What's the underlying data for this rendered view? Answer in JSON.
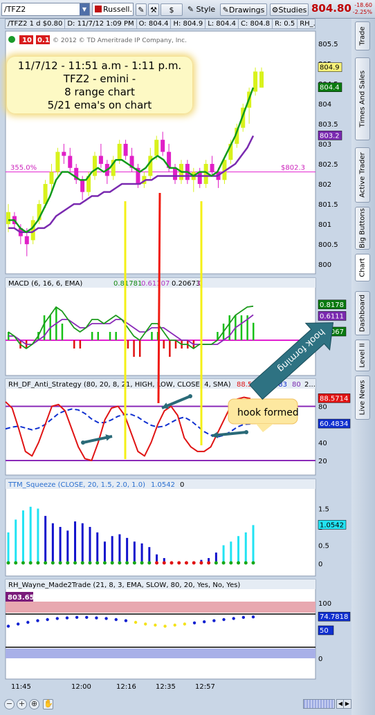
{
  "toolbar": {
    "symbol": "/TFZ2",
    "group": "Russell...",
    "style_label": "Style",
    "drawings_label": "Drawings",
    "studies_label": "Studies",
    "dollar_label": "$",
    "last_price": "804.80",
    "change": "-18.60",
    "change_pct": "-2.25%"
  },
  "header": {
    "symbol_info": "/TFZ2 1 d $0.80",
    "datetime": "D: 11/7/12 1:09 PM",
    "open": "O: 804.4",
    "high": "H: 804.9",
    "low": "L: 804.4",
    "close": "C: 804.8",
    "range": "R: 0.5",
    "study": "RH_...",
    "badge1": "10",
    "badge2": "0.1",
    "copyright": "© 2012 © TD Ameritrade IP Company, Inc."
  },
  "note": {
    "line1": "11/7/12 - 11:51 a.m - 1:11 p.m.",
    "line2": "TFZ2 - emini -",
    "line3": "8 range chart",
    "line4": "5/21 ema's on chart"
  },
  "colors": {
    "up_candle": "#d8f21c",
    "down_candle": "#e01fc7",
    "ema5": "#119a1c",
    "ema21": "#7a2ab0",
    "macd_line": "#1d9a1d",
    "macd_signal": "#8a2ab8",
    "stoch_line": "#e01414",
    "stoch_avg": "#1030d0",
    "squeeze_bars": "#1212cc",
    "squeeze_cyan": "#22e3f3",
    "yellow_line": "#f4f017",
    "red_line": "#f01a10",
    "arrow": "#2a6a78"
  },
  "panels": {
    "price": {
      "pct_label": "355.0%",
      "level_label": "$802.3",
      "level_value": 802.3,
      "y_ticks": [
        "805.5",
        "805",
        "804.5",
        "804",
        "803.5",
        "803",
        "802.5",
        "802",
        "801.5",
        "801",
        "800.5",
        "800"
      ],
      "y_range": [
        799.9,
        805.6
      ],
      "tag_close": "804.4",
      "tag_high": "804.9",
      "tag_ema21": "803.2"
    },
    "macd": {
      "label": "MACD (6, 16, 6, EMA)",
      "v1": "0.81781",
      "v2": "0.61107",
      "v3": "0.20673",
      "v4": "0",
      "tags": [
        "0.8178",
        "0.6111",
        "0.2067"
      ],
      "y_ticks": [
        "0"
      ]
    },
    "stoch": {
      "label": "RH_DF_Anti_Strategy (80, 20, 8, 21, HIGH, LOW, CLOSE, 4, SMA)",
      "v1": "88.571",
      "v2": "60.483",
      "v3": "80",
      "v4": "2...",
      "tags": [
        "88.5714",
        "60.4834"
      ],
      "y_ticks": [
        "80",
        "60",
        "40",
        "20"
      ],
      "hook_formed": "hook formed",
      "hook_forming": "hook forming"
    },
    "squeeze": {
      "label": "TTM_Squeeze (CLOSE, 20, 1.5, 2.0, 1.0)",
      "v1": "1.0542",
      "v2": "0",
      "tag": "1.0542",
      "y_ticks": [
        "1.5",
        "1",
        "0.5",
        "0"
      ]
    },
    "wayne": {
      "label": "RH_Wayne_Made2Trade (21, 8, 3, EMA, SLOW, 80, 20, Yes, No, Yes)",
      "badge": "803.65",
      "tags": [
        "74.7818",
        "50"
      ],
      "y_ticks": [
        "100",
        "50",
        "0"
      ]
    }
  },
  "x_axis": {
    "labels": [
      "11:45",
      "12:00",
      "12:16",
      "12:35",
      "12:57"
    ]
  },
  "sidebar_tabs": [
    "Trade",
    "Times And Sales",
    "Active Trader",
    "Big Buttons",
    "Chart",
    "Dashboard",
    "Level II",
    "Live News"
  ],
  "chart_data": {
    "type": "line",
    "title": "",
    "x_labels": [
      "11:45",
      "12:00",
      "12:16",
      "12:35",
      "12:57"
    ],
    "candles": [
      {
        "o": 801.0,
        "h": 801.5,
        "l": 800.8,
        "c": 801.3
      },
      {
        "o": 801.2,
        "h": 801.3,
        "l": 800.9,
        "c": 801.0
      },
      {
        "o": 800.9,
        "h": 801.0,
        "l": 800.5,
        "c": 800.7
      },
      {
        "o": 800.7,
        "h": 800.9,
        "l": 800.2,
        "c": 800.5
      },
      {
        "o": 800.6,
        "h": 801.2,
        "l": 800.5,
        "c": 801.1
      },
      {
        "o": 801.1,
        "h": 801.6,
        "l": 801.0,
        "c": 801.5
      },
      {
        "o": 801.5,
        "h": 802.1,
        "l": 801.4,
        "c": 802.0
      },
      {
        "o": 802.0,
        "h": 802.5,
        "l": 801.8,
        "c": 802.3
      },
      {
        "o": 802.3,
        "h": 802.9,
        "l": 802.2,
        "c": 802.8
      },
      {
        "o": 802.8,
        "h": 803.0,
        "l": 802.5,
        "c": 802.7
      },
      {
        "o": 802.7,
        "h": 802.9,
        "l": 802.3,
        "c": 802.4
      },
      {
        "o": 802.4,
        "h": 802.5,
        "l": 802.0,
        "c": 802.1
      },
      {
        "o": 802.1,
        "h": 802.2,
        "l": 801.6,
        "c": 801.8
      },
      {
        "o": 801.8,
        "h": 802.3,
        "l": 801.7,
        "c": 802.2
      },
      {
        "o": 802.2,
        "h": 802.8,
        "l": 802.1,
        "c": 802.7
      },
      {
        "o": 802.7,
        "h": 803.0,
        "l": 802.4,
        "c": 802.5
      },
      {
        "o": 802.5,
        "h": 802.6,
        "l": 802.0,
        "c": 802.2
      },
      {
        "o": 802.2,
        "h": 802.7,
        "l": 802.1,
        "c": 802.6
      },
      {
        "o": 802.6,
        "h": 803.1,
        "l": 802.5,
        "c": 803.0
      },
      {
        "o": 803.0,
        "h": 803.1,
        "l": 802.6,
        "c": 802.7
      },
      {
        "o": 802.7,
        "h": 802.9,
        "l": 802.3,
        "c": 802.4
      },
      {
        "o": 802.4,
        "h": 802.5,
        "l": 801.9,
        "c": 802.0
      },
      {
        "o": 802.0,
        "h": 802.3,
        "l": 801.9,
        "c": 802.2
      },
      {
        "o": 802.2,
        "h": 802.9,
        "l": 802.1,
        "c": 802.7
      },
      {
        "o": 802.7,
        "h": 803.2,
        "l": 802.6,
        "c": 803.1
      },
      {
        "o": 803.1,
        "h": 803.3,
        "l": 802.7,
        "c": 802.8
      },
      {
        "o": 802.8,
        "h": 803.0,
        "l": 802.3,
        "c": 802.4
      },
      {
        "o": 802.4,
        "h": 802.5,
        "l": 802.0,
        "c": 802.1
      },
      {
        "o": 802.1,
        "h": 802.6,
        "l": 802.0,
        "c": 802.5
      },
      {
        "o": 802.5,
        "h": 802.6,
        "l": 802.0,
        "c": 802.1
      },
      {
        "o": 802.1,
        "h": 802.4,
        "l": 801.8,
        "c": 802.3
      },
      {
        "o": 802.3,
        "h": 802.4,
        "l": 801.9,
        "c": 802.0
      },
      {
        "o": 802.0,
        "h": 802.6,
        "l": 801.9,
        "c": 802.5
      },
      {
        "o": 802.5,
        "h": 802.7,
        "l": 802.2,
        "c": 802.3
      },
      {
        "o": 802.3,
        "h": 802.4,
        "l": 801.9,
        "c": 802.1
      },
      {
        "o": 802.1,
        "h": 802.7,
        "l": 802.0,
        "c": 802.6
      },
      {
        "o": 802.6,
        "h": 803.1,
        "l": 802.5,
        "c": 803.0
      },
      {
        "o": 803.0,
        "h": 803.5,
        "l": 802.9,
        "c": 803.4
      },
      {
        "o": 803.4,
        "h": 804.0,
        "l": 803.3,
        "c": 803.9
      },
      {
        "o": 803.9,
        "h": 804.4,
        "l": 803.5,
        "c": 804.3
      },
      {
        "o": 804.3,
        "h": 804.9,
        "l": 804.2,
        "c": 804.8
      },
      {
        "o": 804.4,
        "h": 804.9,
        "l": 804.4,
        "c": 804.8
      }
    ],
    "ema5": [
      801.1,
      801.1,
      800.9,
      800.8,
      800.9,
      801.1,
      801.4,
      801.7,
      802.1,
      802.3,
      802.3,
      802.2,
      802.1,
      802.1,
      802.3,
      802.4,
      802.3,
      802.4,
      802.6,
      802.6,
      802.5,
      802.4,
      802.3,
      802.4,
      802.6,
      802.7,
      802.6,
      802.4,
      802.4,
      802.3,
      802.3,
      802.2,
      802.3,
      802.3,
      802.2,
      802.3,
      802.6,
      802.9,
      803.2,
      803.6,
      804.0,
      804.4
    ],
    "ema21": [
      800.9,
      800.9,
      800.8,
      800.8,
      800.8,
      800.9,
      800.9,
      801.0,
      801.2,
      801.3,
      801.4,
      801.5,
      801.5,
      801.6,
      801.7,
      801.7,
      801.8,
      801.8,
      801.9,
      802.0,
      802.0,
      802.0,
      802.0,
      802.1,
      802.1,
      802.2,
      802.2,
      802.2,
      802.2,
      802.2,
      802.2,
      802.2,
      802.2,
      802.2,
      802.2,
      802.2,
      802.3,
      802.4,
      802.5,
      802.7,
      802.9,
      803.2
    ],
    "macd_line": [
      0.2,
      0.1,
      -0.1,
      -0.2,
      -0.1,
      0.1,
      0.4,
      0.6,
      0.8,
      0.7,
      0.5,
      0.3,
      0.2,
      0.3,
      0.5,
      0.5,
      0.4,
      0.5,
      0.6,
      0.5,
      0.3,
      0.1,
      0.0,
      0.2,
      0.4,
      0.4,
      0.2,
      0.0,
      0.0,
      -0.1,
      -0.1,
      -0.2,
      -0.1,
      -0.1,
      -0.1,
      0.0,
      0.2,
      0.4,
      0.6,
      0.7,
      0.8,
      0.82
    ],
    "macd_signal": [
      0.1,
      0.1,
      0.0,
      -0.1,
      -0.1,
      0.0,
      0.1,
      0.3,
      0.4,
      0.5,
      0.5,
      0.4,
      0.3,
      0.3,
      0.4,
      0.4,
      0.4,
      0.4,
      0.5,
      0.5,
      0.4,
      0.3,
      0.2,
      0.2,
      0.3,
      0.3,
      0.3,
      0.2,
      0.1,
      0.0,
      0.0,
      -0.1,
      -0.1,
      -0.1,
      -0.1,
      -0.1,
      0.0,
      0.1,
      0.3,
      0.4,
      0.5,
      0.61
    ],
    "stoch_line": [
      85,
      78,
      55,
      30,
      25,
      40,
      60,
      80,
      82,
      75,
      55,
      35,
      22,
      20,
      40,
      65,
      78,
      80,
      70,
      50,
      30,
      25,
      40,
      60,
      75,
      80,
      70,
      45,
      35,
      30,
      30,
      35,
      50,
      65,
      80,
      88,
      90,
      88.57
    ],
    "stoch_avg": [
      55,
      57,
      58,
      56,
      54,
      56,
      60,
      66,
      72,
      75,
      77,
      76,
      72,
      66,
      62,
      62,
      65,
      69,
      71,
      71,
      68,
      63,
      59,
      57,
      58,
      62,
      66,
      68,
      64,
      58,
      52,
      48,
      46,
      48,
      52,
      57,
      60,
      60.48
    ],
    "squeeze_hist": [
      0.85,
      1.2,
      1.45,
      1.55,
      1.5,
      1.3,
      1.1,
      1.0,
      0.9,
      1.15,
      1.1,
      1.0,
      0.85,
      0.6,
      0.75,
      0.8,
      0.7,
      0.6,
      0.55,
      0.45,
      0.25,
      0.15,
      0.05,
      0.05,
      0.05,
      0.05,
      0.1,
      0.15,
      0.3,
      0.5,
      0.6,
      0.75,
      0.85,
      1.05
    ],
    "wayne_line": [
      58,
      62,
      65,
      68,
      70,
      72,
      73,
      74,
      74,
      73,
      72,
      70,
      68,
      65,
      62,
      60,
      58,
      60,
      62,
      64,
      66,
      68,
      70,
      72,
      74,
      74.78
    ]
  }
}
